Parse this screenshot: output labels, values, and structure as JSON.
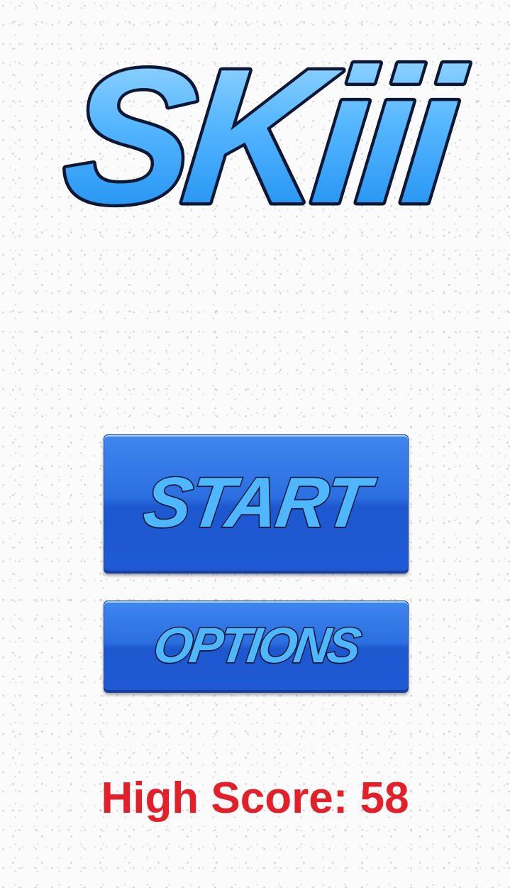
{
  "game": {
    "title": "SKiii",
    "start_label": "START",
    "options_label": "OPTIONS",
    "high_score_label": "High Score:",
    "high_score_value": "58",
    "high_score_text": "High Score: 58"
  },
  "colors": {
    "title_fill_top": "#8dd4ff",
    "title_fill_bottom": "#1a8cf0",
    "title_outline": "#0b1733",
    "button_blue": "#2b6fe0",
    "button_text": "#4fb7ff",
    "high_score": "#e3202a",
    "background": "#fbfbfb"
  }
}
